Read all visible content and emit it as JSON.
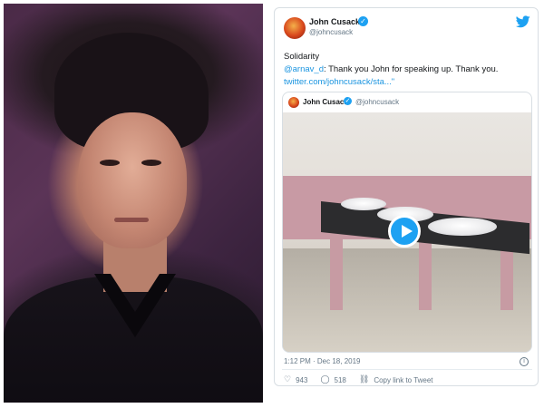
{
  "photo": {
    "subject": "portrait-photo"
  },
  "tweet": {
    "author_name": "John Cusack",
    "author_handle": "@johncusack",
    "verified_icon": "verified-check-icon",
    "line1": "Solidarity",
    "mention": "@arnav_d",
    "line2_rest": ": Thank you John for speaking up. Thank you.",
    "link": "twitter.com/johncusack/sta...\"",
    "quoted": {
      "author_name": "John Cusack",
      "author_handle": "@johncusack"
    },
    "timestamp": "1:12 PM · Dec 18, 2019",
    "likes": "943",
    "replies": "518",
    "copy_link": "Copy link to Tweet"
  },
  "colors": {
    "twitter_blue": "#1da1f2",
    "link_blue": "#1b95e0",
    "text": "#14171a",
    "muted": "#657786"
  }
}
